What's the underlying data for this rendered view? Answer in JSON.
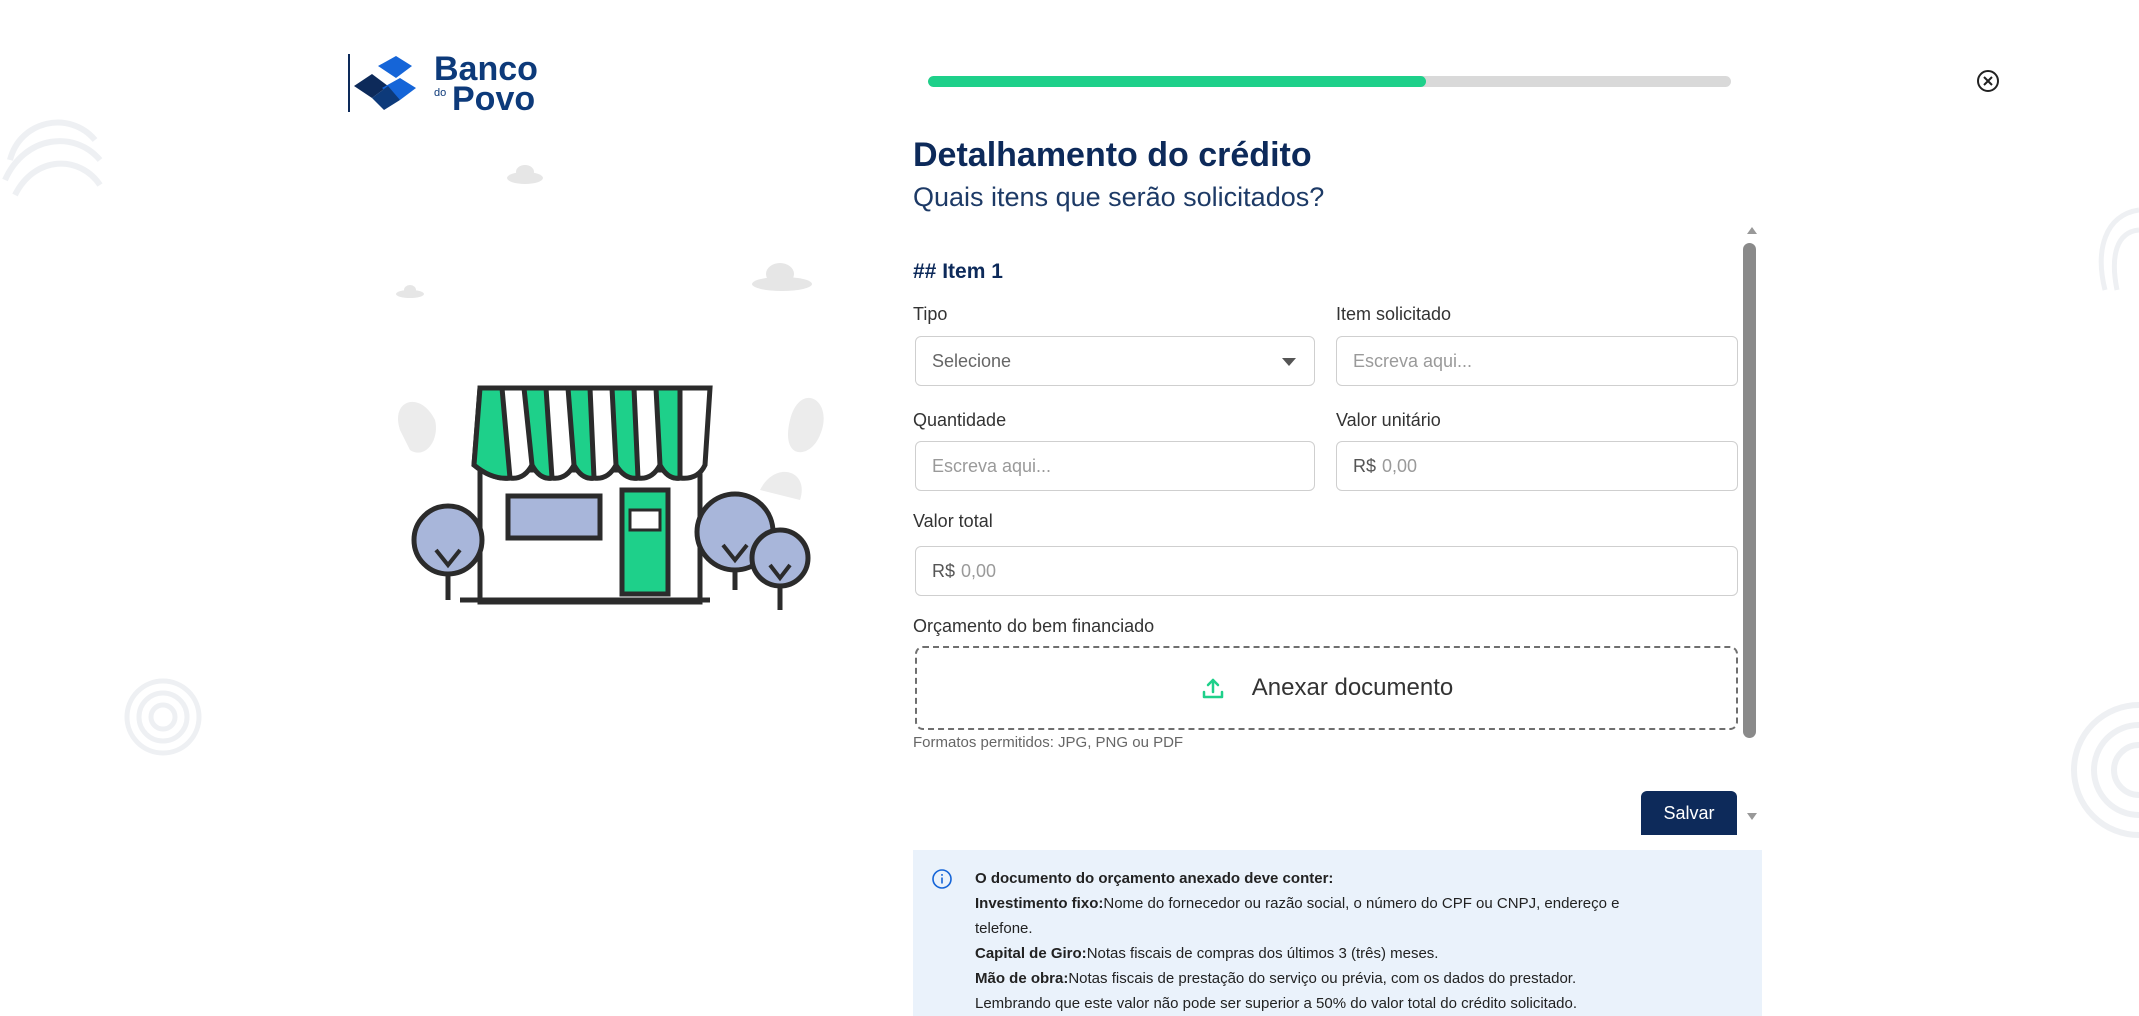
{
  "brand": {
    "line1": "Banco",
    "line2_small": "do",
    "line3": "Povo",
    "colors": {
      "navy": "#0d2a5a",
      "blue": "#1565d8",
      "green": "#1ed08a"
    }
  },
  "progress": {
    "percent": 62
  },
  "close": {
    "icon": "close-circle-icon"
  },
  "header": {
    "title": "Detalhamento do crédito",
    "subtitle": "Quais itens que serão solicitados?"
  },
  "form": {
    "item_heading": "## Item 1",
    "tipo": {
      "label": "Tipo",
      "value": "Selecione"
    },
    "item_solicitado": {
      "label": "Item solicitado",
      "placeholder": "Escreva aqui..."
    },
    "quantidade": {
      "label": "Quantidade",
      "placeholder": "Escreva aqui..."
    },
    "valor_unitario": {
      "label": "Valor unitário",
      "prefix": "R$",
      "placeholder": "0,00"
    },
    "valor_total": {
      "label": "Valor total",
      "prefix": "R$",
      "placeholder": "0,00"
    },
    "orcamento": {
      "label": "Orçamento do bem financiado",
      "upload_label": "Anexar documento",
      "upload_icon": "upload-icon",
      "hint": "Formatos permitidos: JPG, PNG ou PDF"
    },
    "save_label": "Salvar"
  },
  "info": {
    "icon": "info-icon",
    "heading": "O documento do orçamento anexado deve conter:",
    "items": [
      {
        "term": "Investimento fixo:",
        "text": "Nome do fornecedor ou razão social, o número do CPF ou CNPJ, endereço e"
      },
      {
        "term": "",
        "text": "telefone."
      },
      {
        "term": "Capital de Giro:",
        "text": "Notas fiscais de compras dos últimos 3 (três) meses."
      },
      {
        "term": "Mão de obra:",
        "text": "Notas fiscais de prestação do serviço ou prévia, com os dados do prestador."
      },
      {
        "term": "",
        "text": "Lembrando que este valor não pode ser superior a 50% do valor total do crédito solicitado."
      }
    ]
  }
}
